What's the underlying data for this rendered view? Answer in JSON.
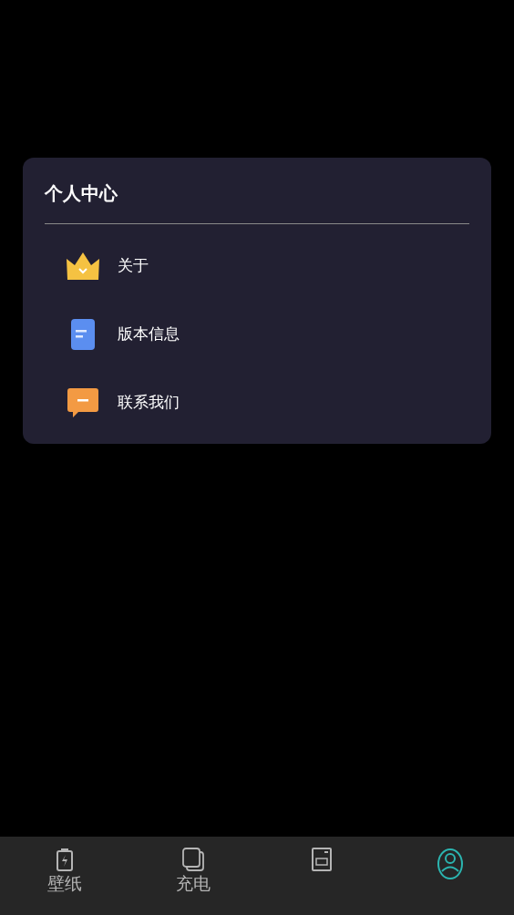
{
  "card": {
    "title": "个人中心",
    "items": [
      {
        "kind": "crown",
        "label": "关于"
      },
      {
        "kind": "document",
        "label": "版本信息"
      },
      {
        "kind": "chat",
        "label": "联系我们"
      }
    ]
  },
  "tab_bar": [
    {
      "kind": "battery",
      "label": "壁纸",
      "selected": false
    },
    {
      "kind": "pages",
      "label": "充电",
      "selected": false
    },
    {
      "kind": "device",
      "selected": false
    },
    {
      "kind": "person",
      "selected": true
    }
  ]
}
